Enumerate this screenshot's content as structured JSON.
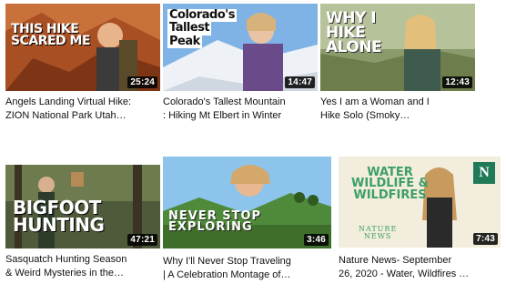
{
  "videos": [
    {
      "thumb_text": "THIS HIKE SCARED ME",
      "thumb_text_lines": [
        "THIS HIKE",
        "SCARED ME"
      ],
      "duration": "25:24",
      "title_lines": [
        "Angels Landing Virtual Hike:",
        "ZION National Park Utah…"
      ]
    },
    {
      "thumb_text_lines": [
        "Colorado's",
        "Tallest",
        "Peak"
      ],
      "duration": "14:47",
      "title_lines": [
        "Colorado's Tallest Mountain",
        ": Hiking Mt Elbert in Winter"
      ]
    },
    {
      "thumb_text_lines": [
        "WHY I",
        "HIKE",
        "ALONE"
      ],
      "duration": "12:43",
      "title_lines": [
        "Yes I am a Woman and I",
        "Hike Solo (Smoky…"
      ]
    },
    {
      "thumb_text_lines": [
        "BIGFOOT",
        "HUNTING"
      ],
      "duration": "47:21",
      "title_lines": [
        "Sasquatch Hunting Season",
        "& Weird Mysteries in the…"
      ]
    },
    {
      "thumb_text_lines": [
        "NEVER STOP",
        "EXPLORING"
      ],
      "duration": "3:46",
      "title_lines": [
        "Why I'll Never Stop Traveling",
        "| A Celebration Montage of…"
      ]
    },
    {
      "thumb_text_lines": [
        "WATER",
        "WILDLIFE &",
        "WILDFIRES"
      ],
      "thumb_subtext_lines": [
        "NATURE",
        "NEWS"
      ],
      "logo_letter": "N",
      "duration": "7:43",
      "title_lines": [
        "Nature News- September",
        "26, 2020 - Water, Wildfires …"
      ]
    }
  ]
}
